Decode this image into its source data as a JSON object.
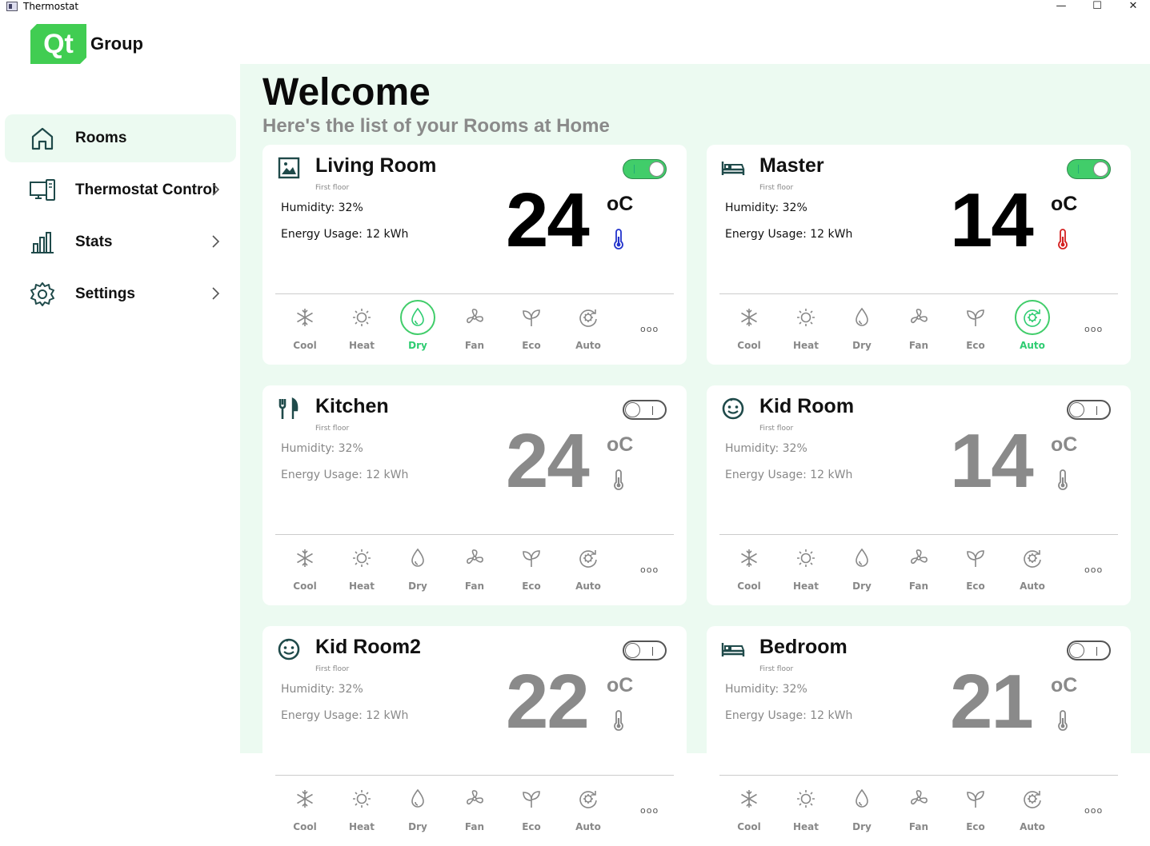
{
  "window": {
    "title": "Thermostat",
    "minimize": "—",
    "maximize": "☐",
    "close": "✕"
  },
  "logo": {
    "mark": "Qt",
    "text": "Group"
  },
  "sidebar": {
    "items": [
      {
        "label": "Rooms",
        "icon": "home-icon",
        "active": true
      },
      {
        "label": "Thermostat Control",
        "icon": "thermostat-device-icon",
        "active": false
      },
      {
        "label": "Stats",
        "icon": "bar-chart-icon",
        "active": false
      },
      {
        "label": "Settings",
        "icon": "gear-icon",
        "active": false
      }
    ]
  },
  "header": {
    "title": "Welcome",
    "subtitle": "Here's the list of your Rooms at Home"
  },
  "modes": [
    "Cool",
    "Heat",
    "Dry",
    "Fan",
    "Eco",
    "Auto"
  ],
  "more_label": "ooo",
  "rooms": [
    {
      "name": "Living Room",
      "icon": "picture-icon",
      "floor": "First floor",
      "humidity": "Humidity: 32%",
      "energy": "Energy Usage: 12 kWh",
      "temp": "24",
      "unit": "oC",
      "on": true,
      "selected_mode": "Dry",
      "thermo_color": "#2233cc"
    },
    {
      "name": "Master",
      "icon": "bed-icon",
      "floor": "First floor",
      "humidity": "Humidity: 32%",
      "energy": "Energy Usage: 12 kWh",
      "temp": "14",
      "unit": "oC",
      "on": true,
      "selected_mode": "Auto",
      "thermo_color": "#d42020"
    },
    {
      "name": "Kitchen",
      "icon": "fork-knife-icon",
      "floor": "First floor",
      "humidity": "Humidity: 32%",
      "energy": "Energy Usage: 12 kWh",
      "temp": "24",
      "unit": "oC",
      "on": false,
      "selected_mode": "",
      "thermo_color": "#888888"
    },
    {
      "name": "Kid Room",
      "icon": "smiley-icon",
      "floor": "First floor",
      "humidity": "Humidity: 32%",
      "energy": "Energy Usage: 12 kWh",
      "temp": "14",
      "unit": "oC",
      "on": false,
      "selected_mode": "",
      "thermo_color": "#888888"
    },
    {
      "name": "Kid Room2",
      "icon": "smiley-icon",
      "floor": "First floor",
      "humidity": "Humidity: 32%",
      "energy": "Energy Usage: 12 kWh",
      "temp": "22",
      "unit": "oC",
      "on": false,
      "selected_mode": "",
      "thermo_color": "#888888"
    },
    {
      "name": "Bedroom",
      "icon": "bed-icon",
      "floor": "First floor",
      "humidity": "Humidity: 32%",
      "energy": "Energy Usage: 12 kWh",
      "temp": "21",
      "unit": "oC",
      "on": false,
      "selected_mode": "",
      "thermo_color": "#888888"
    }
  ],
  "colors": {
    "accent": "#41cd6a",
    "panel_bg": "#ecfaf1",
    "muted": "#888888",
    "icon_dark": "#1f4a4a"
  }
}
